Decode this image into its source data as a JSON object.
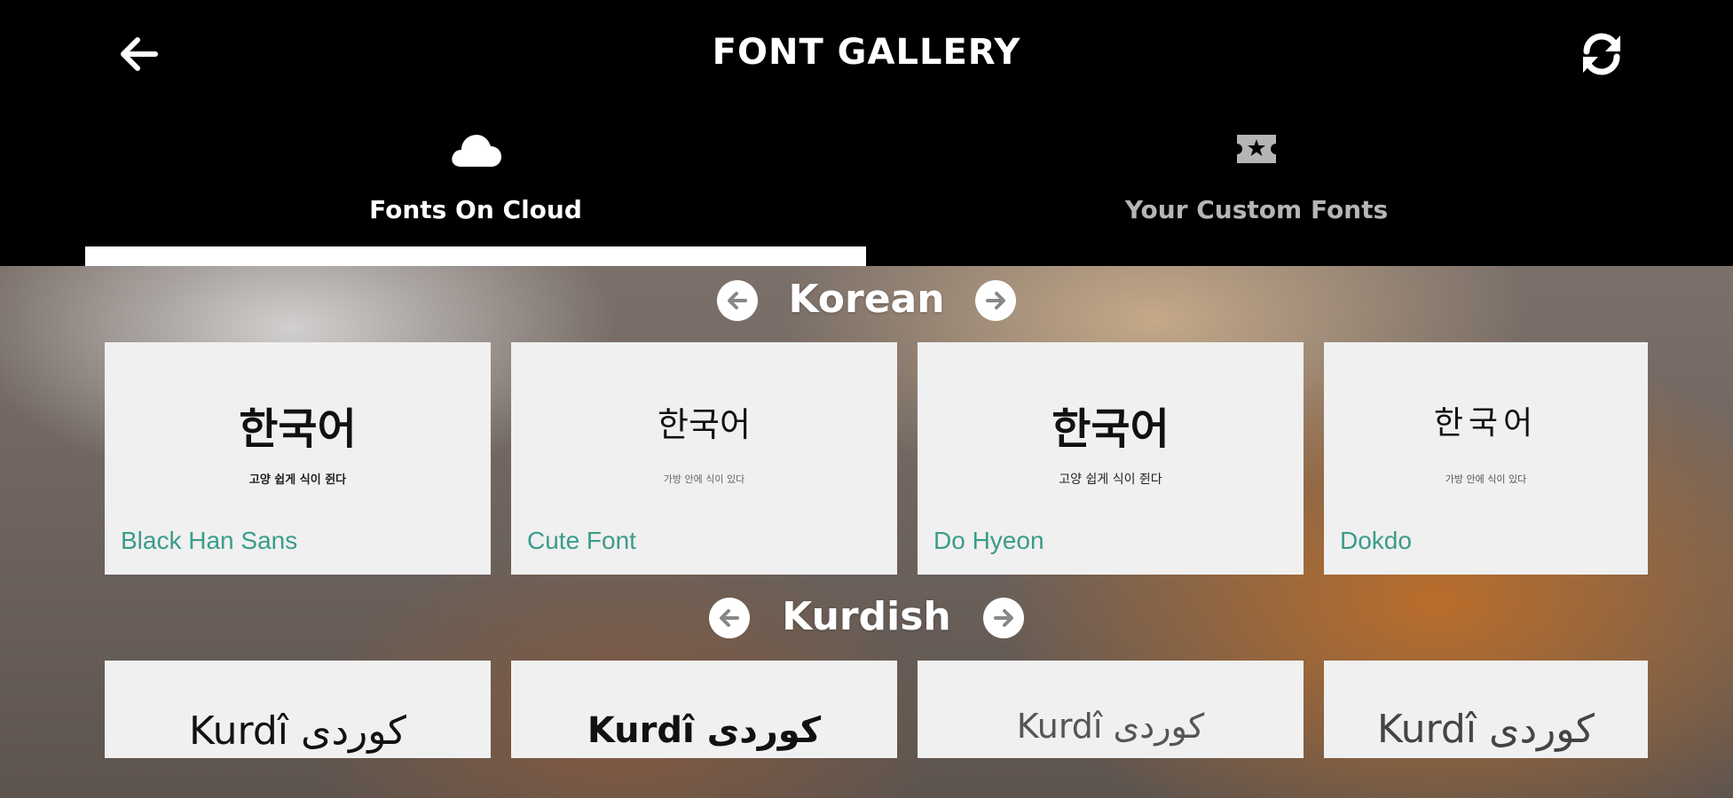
{
  "header": {
    "title": "FONT GALLERY",
    "back_icon": "arrow-left-icon",
    "refresh_icon": "refresh-icon"
  },
  "tabs": [
    {
      "label": "Fonts On Cloud",
      "icon": "cloud-icon",
      "active": true
    },
    {
      "label": "Your Custom Fonts",
      "icon": "star-ticket-icon",
      "active": false
    }
  ],
  "sections": [
    {
      "title": "Korean",
      "cards": [
        {
          "sample": "한국어",
          "subtext": "고양 쉽게 식이 쥔다",
          "name": "Black Han Sans"
        },
        {
          "sample": "한국어",
          "subtext": "가방 안에 식이 있다",
          "name": "Cute Font"
        },
        {
          "sample": "한국어",
          "subtext": "고양 쉽게 식이 쥔다",
          "name": "Do Hyeon"
        },
        {
          "sample": "한국어",
          "subtext": "가방 안에 식이 있다",
          "name": "Dokdo"
        }
      ]
    },
    {
      "title": "Kurdish",
      "cards": [
        {
          "sample": "Kurdî کوردی"
        },
        {
          "sample": "Kurdî کوردی"
        },
        {
          "sample": "Kurdî کوردی"
        },
        {
          "sample": "Kurdî کوردی"
        }
      ]
    }
  ],
  "colors": {
    "accent_name": "#3a9c8a",
    "header_bg": "#000000",
    "card_bg": "#f0f0f0"
  }
}
